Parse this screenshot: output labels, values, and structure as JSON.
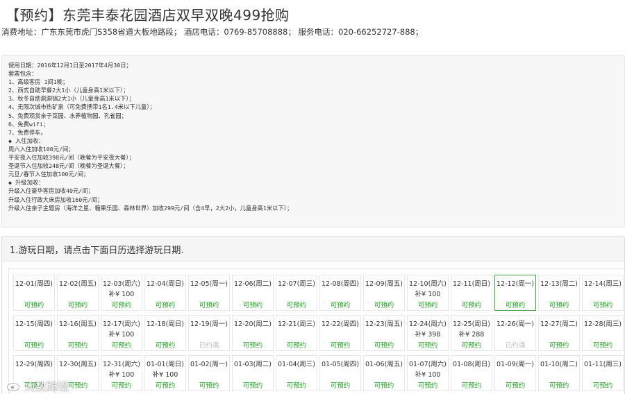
{
  "header": {
    "title": "【预约】东莞丰泰花园酒店双早双晚499抢购",
    "info": "消费地址：广东东莞市虎门S358省道大板地路段； 酒店电话：0769-85708888； 服务电话：020-66252727-888；"
  },
  "package_lines": [
    "使用日期：2016年12月1日至2017年4月30日；",
    "套票包含：",
    "1、高级客房 1间1晚；",
    "2、西式自助早餐2大1小（儿童身高1米以下）；",
    "3、秋冬自助涮涮锅2大1小（儿童身高1米以下）；",
    "4、无限次城市热矿泉（可免费携带1名1.4米以下儿童）；",
    "5、免费观赏亲子菜园、水养植物园、孔雀园；",
    "6、免费wifi；",
    "7、免费停车。",
    "◆ 入住加收：",
    "周六入住加收100元/间；",
    "平安夜入住加收398元/间（晚餐为平安夜大餐）；",
    "圣诞节入住加收248元/间（晚餐为圣诞大餐）；",
    "元旦/春节入住加收100元/间；",
    "◆ 升级加收：",
    "升级入住豪华客房加收40元/间；",
    "升级入住行政大床房加收160元/间；",
    "升级入住亲子主题房（海洋之星、糖果乐园、森林世界）加收299元/间（含4早，2大2小，儿童身高1米以下）；"
  ],
  "date_select": {
    "header": "1.游玩日期，请点击下面日历选择游玩日期."
  },
  "calendar_rows": [
    [
      {
        "date": "12-01(周四)",
        "price": "",
        "status": "可预约"
      },
      {
        "date": "12-02(周五)",
        "price": "",
        "status": "可预约"
      },
      {
        "date": "12-03(周六)",
        "price": "补¥ 100",
        "status": "可预约"
      },
      {
        "date": "12-04(周日)",
        "price": "",
        "status": "可预约"
      },
      {
        "date": "12-05(周一)",
        "price": "",
        "status": "可预约"
      },
      {
        "date": "12-06(周二)",
        "price": "",
        "status": "可预约"
      },
      {
        "date": "12-07(周三)",
        "price": "",
        "status": "可预约"
      },
      {
        "date": "12-08(周四)",
        "price": "",
        "status": "可预约"
      },
      {
        "date": "12-09(周五)",
        "price": "",
        "status": "可预约"
      },
      {
        "date": "12-10(周六)",
        "price": "补¥ 100",
        "status": "可预约"
      },
      {
        "date": "12-11(周日)",
        "price": "",
        "status": "可预约"
      },
      {
        "date": "12-12(周一)",
        "price": "",
        "status": "可预约",
        "selected": true
      },
      {
        "date": "12-13(周二)",
        "price": "",
        "status": "可预约"
      },
      {
        "date": "12-14(周三)",
        "price": "",
        "status": "可预约"
      }
    ],
    [
      {
        "date": "12-15(周四)",
        "price": "",
        "status": "可预约"
      },
      {
        "date": "12-16(周五)",
        "price": "",
        "status": "可预约"
      },
      {
        "date": "12-17(周六)",
        "price": "补¥ 100",
        "status": "可预约"
      },
      {
        "date": "12-18(周日)",
        "price": "",
        "status": "可预约"
      },
      {
        "date": "12-19(周一)",
        "price": "",
        "status": "已约满",
        "full": true
      },
      {
        "date": "12-20(周二)",
        "price": "",
        "status": "可预约"
      },
      {
        "date": "12-21(周三)",
        "price": "",
        "status": "可预约"
      },
      {
        "date": "12-22(周四)",
        "price": "",
        "status": "可预约"
      },
      {
        "date": "12-23(周五)",
        "price": "",
        "status": "可预约"
      },
      {
        "date": "12-24(周六)",
        "price": "补¥ 398",
        "status": "可预约"
      },
      {
        "date": "12-25(周日)",
        "price": "补¥ 288",
        "status": "可预约"
      },
      {
        "date": "12-26(周一)",
        "price": "",
        "status": "已约满",
        "full": true
      },
      {
        "date": "12-27(周二)",
        "price": "",
        "status": "可预约"
      },
      {
        "date": "12-28(周三)",
        "price": "",
        "status": "可预约"
      }
    ],
    [
      {
        "date": "12-29(周四)",
        "price": "",
        "status": "可预约"
      },
      {
        "date": "12-30(周五)",
        "price": "",
        "status": "可预约"
      },
      {
        "date": "12-31(周六)",
        "price": "补¥ 100",
        "status": "可预约"
      },
      {
        "date": "01-01(周日)",
        "price": "补¥ 100",
        "status": "可预约"
      },
      {
        "date": "01-02(周一)",
        "price": "",
        "status": "可预约"
      },
      {
        "date": "01-03(周二)",
        "price": "",
        "status": "可预约"
      },
      {
        "date": "01-04(周三)",
        "price": "",
        "status": "可预约"
      },
      {
        "date": "01-05(周四)",
        "price": "",
        "status": "可预约"
      },
      {
        "date": "01-06(周五)",
        "price": "",
        "status": "可预约"
      },
      {
        "date": "01-07(周六)",
        "price": "补¥ 100",
        "status": "可预约"
      },
      {
        "date": "01-08(周日)",
        "price": "",
        "status": "可预约"
      },
      {
        "date": "01-09(周一)",
        "price": "",
        "status": "可预约"
      },
      {
        "date": "01-10(周二)",
        "price": "",
        "status": "可预约"
      },
      {
        "date": "01-11(周三)",
        "price": "",
        "status": "可预约"
      }
    ]
  ],
  "watermark": {
    "text": "大数跨境",
    "icon": "weibo-icon"
  }
}
